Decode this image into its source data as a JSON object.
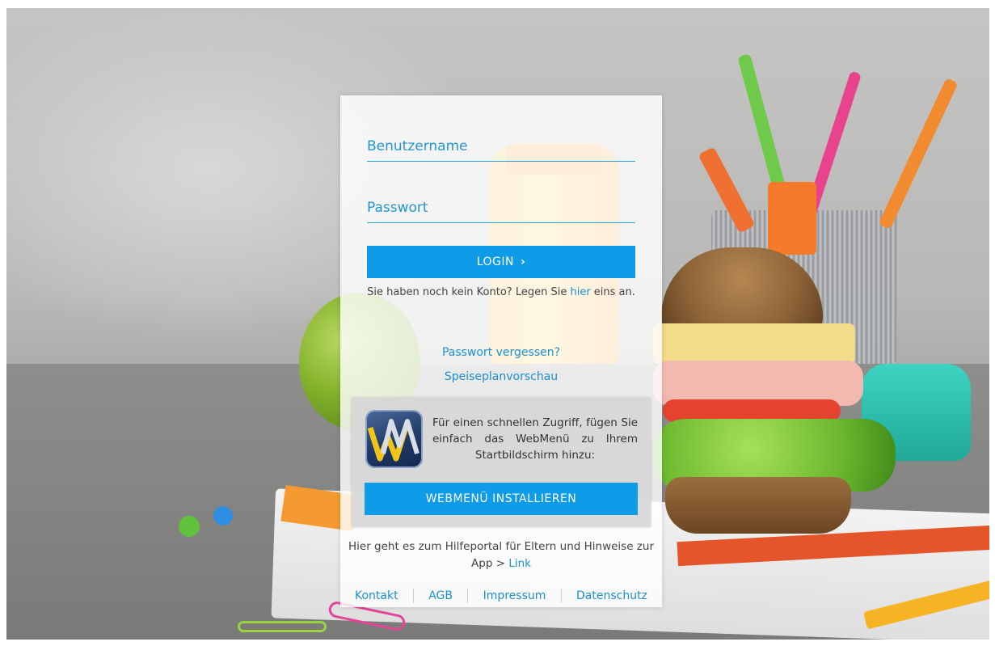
{
  "login": {
    "username_placeholder": "Benutzername",
    "password_placeholder": "Passwort",
    "login_label": "LOGIN",
    "login_chevron": "›",
    "register_prefix": "Sie haben noch kein Konto? Legen Sie ",
    "register_link": "hier",
    "register_suffix": " eins an.",
    "forgot_password": "Passwort vergessen?",
    "menu_preview": "Speiseplanvorschau"
  },
  "install": {
    "icon": "webmenu-app-icon",
    "text": "Für einen schnellen Zugriff, fügen Sie einfach das WebMenü zu Ihrem Startbildschirm hinzu:",
    "button_label": "WEBMENÜ INSTALLIEREN"
  },
  "help": {
    "text": "Hier geht es zum Hilfeportal für Eltern und Hinweise zur App  > ",
    "link": "Link"
  },
  "footer": {
    "contact": "Kontakt",
    "terms": "AGB",
    "imprint": "Impressum",
    "privacy": "Datenschutz"
  },
  "colors": {
    "accent": "#0e9be8",
    "link": "#1a8fd2"
  }
}
